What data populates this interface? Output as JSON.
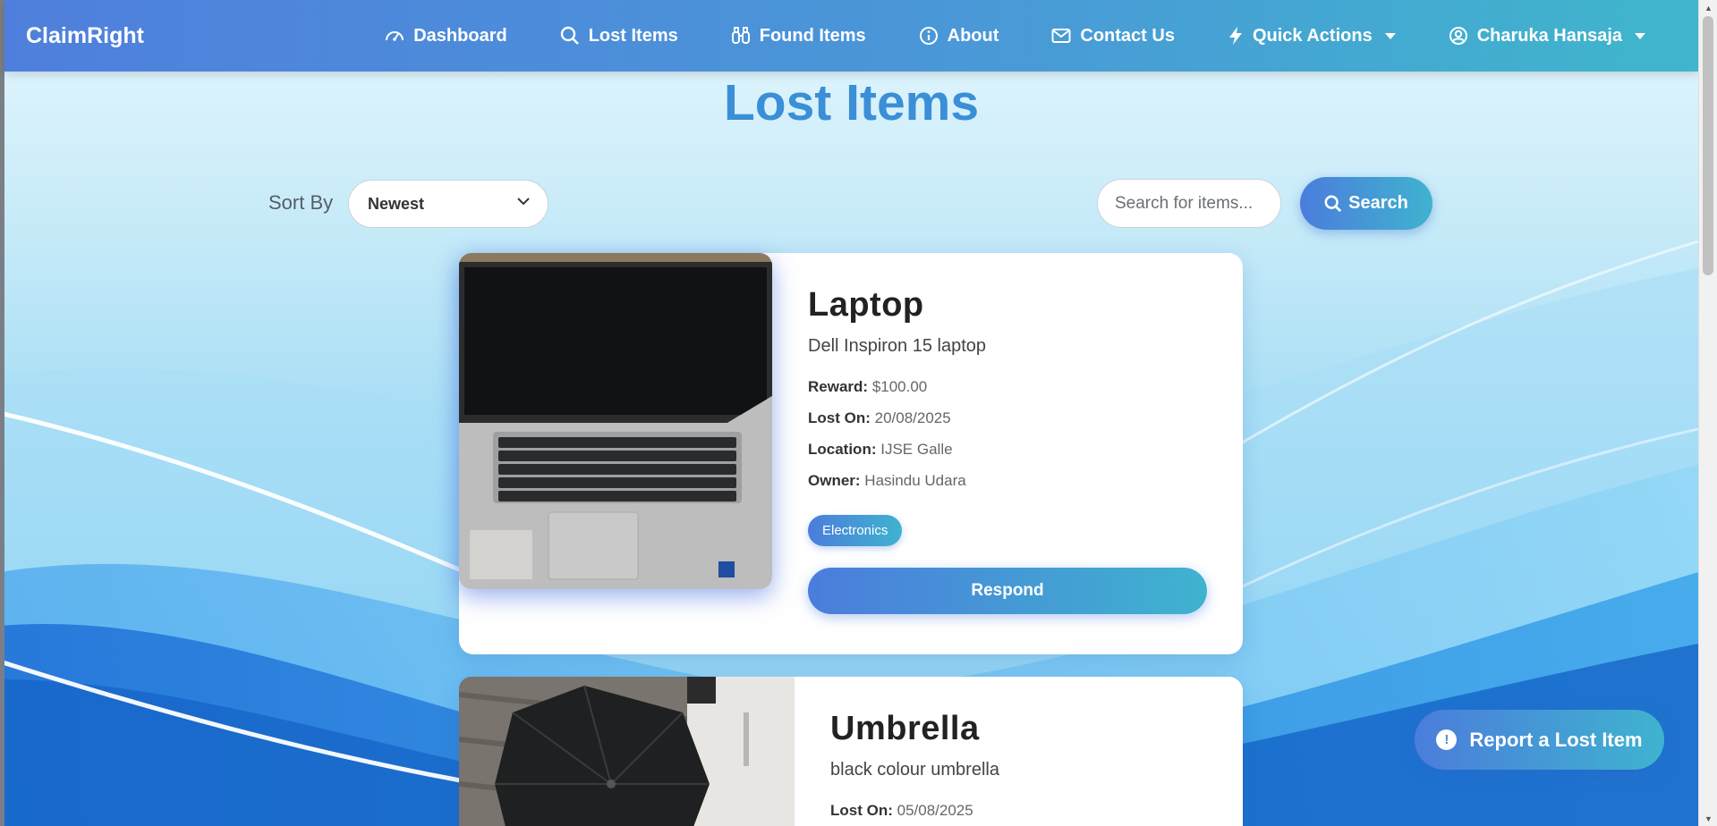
{
  "navbar": {
    "brand": "ClaimRight",
    "items": [
      {
        "label": "Dashboard",
        "icon": "dashboard-icon"
      },
      {
        "label": "Lost Items",
        "icon": "search-icon"
      },
      {
        "label": "Found Items",
        "icon": "binoculars-icon"
      },
      {
        "label": "About",
        "icon": "info-icon"
      },
      {
        "label": "Contact Us",
        "icon": "envelope-icon"
      },
      {
        "label": "Quick Actions",
        "icon": "lightning-icon"
      },
      {
        "label": "Charuka Hansaja",
        "icon": "user-circle-icon"
      }
    ]
  },
  "page": {
    "title": "Lost Items"
  },
  "sort": {
    "label": "Sort By",
    "selected": "Newest"
  },
  "search": {
    "placeholder": "Search for items...",
    "button_label": "Search"
  },
  "items": [
    {
      "title": "Laptop",
      "description": "Dell Inspiron 15 laptop",
      "reward_label": "Reward:",
      "reward": "$100.00",
      "lost_on_label": "Lost On:",
      "lost_on": "20/08/2025",
      "location_label": "Location:",
      "location": "IJSE Galle",
      "owner_label": "Owner:",
      "owner": "Hasindu Udara",
      "category": "Electronics",
      "action": "Respond"
    },
    {
      "title": "Umbrella",
      "description": "black colour umbrella",
      "lost_on_label": "Lost On:",
      "lost_on": "05/08/2025"
    }
  ],
  "report_button": {
    "label": "Report a Lost Item",
    "icon": "exclamation-icon"
  },
  "colors": {
    "accent_start": "#4b7ddc",
    "accent_end": "#3fb3cf",
    "title": "#3a8fd6"
  }
}
